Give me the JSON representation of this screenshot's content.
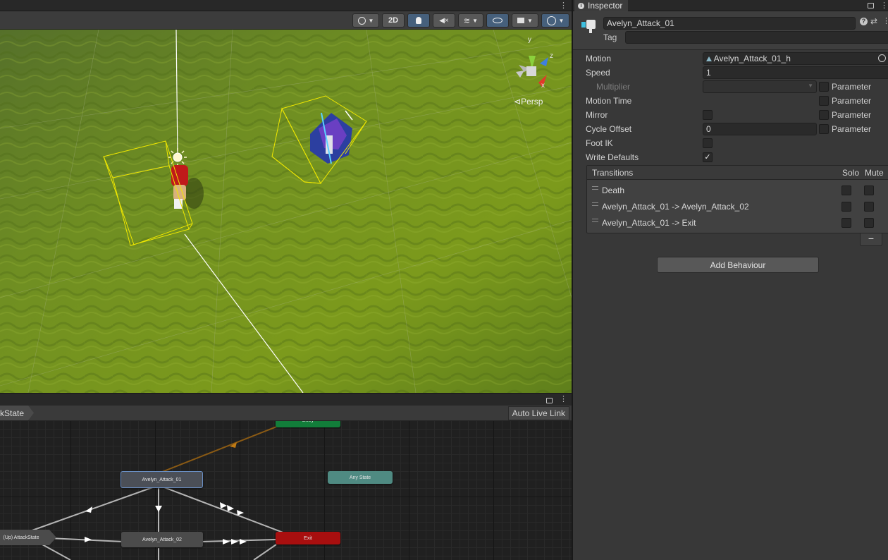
{
  "scene": {
    "toolbar": {
      "mode_2d": "2D"
    },
    "gizmo": {
      "axis_y": "y",
      "axis_x": "x",
      "projection": "Persp"
    }
  },
  "animator": {
    "breadcrumb": "kState",
    "auto_live_link": "Auto Live Link",
    "nodes": {
      "entry": "Entry",
      "attack_01": "Avelyn_Attack_01",
      "any_state": "Any State",
      "attack_state": "(Up) AttackState",
      "attack_02": "Avelyn_Attack_02",
      "exit": "Exit"
    }
  },
  "inspector": {
    "tab_title": "Inspector",
    "object_name": "Avelyn_Attack_01",
    "tag_label": "Tag",
    "props": {
      "motion_label": "Motion",
      "motion_value": "Avelyn_Attack_01_h",
      "speed_label": "Speed",
      "speed_value": "1",
      "multiplier_label": "Multiplier",
      "motion_time_label": "Motion Time",
      "mirror_label": "Mirror",
      "cycle_offset_label": "Cycle Offset",
      "cycle_offset_value": "0",
      "foot_ik_label": "Foot IK",
      "write_defaults_label": "Write Defaults",
      "parameter_label": "Parameter",
      "write_defaults_checked": "✓"
    },
    "transitions": {
      "header": "Transitions",
      "solo": "Solo",
      "mute": "Mute",
      "rows": [
        {
          "name": "Death"
        },
        {
          "name": "Avelyn_Attack_01 -> Avelyn_Attack_02"
        },
        {
          "name": "Avelyn_Attack_01 -> Exit"
        }
      ],
      "remove": "−"
    },
    "add_behaviour": "Add Behaviour"
  },
  "colors": {
    "grass": "#6b8a1e",
    "selection_yellow": "#f0e800",
    "entry_green": "#127d3a",
    "exit_red": "#a80f0f",
    "any_state_teal": "#4f8a82",
    "node_gray": "#4b4b4b",
    "selected_blue": "#6a8fc4"
  }
}
